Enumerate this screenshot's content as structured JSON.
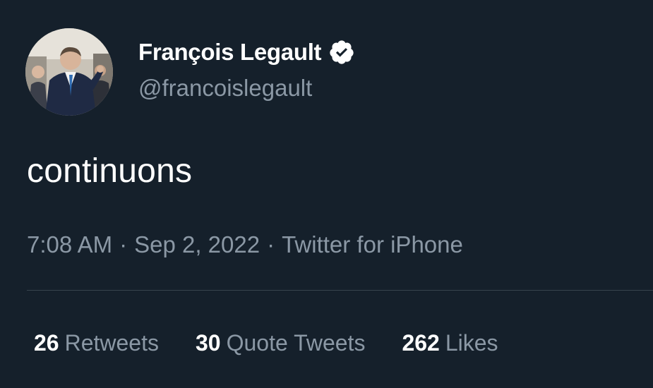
{
  "author": {
    "display_name": "François Legault",
    "handle": "@francoislegault",
    "verified": true,
    "avatar_icon": "profile-photo"
  },
  "tweet": {
    "text": "continuons",
    "time": "7:08 AM",
    "date": "Sep 2, 2022",
    "source": "Twitter for iPhone",
    "separator": "·"
  },
  "stats": [
    {
      "count": "26",
      "label": "Retweets"
    },
    {
      "count": "30",
      "label": "Quote Tweets"
    },
    {
      "count": "262",
      "label": "Likes"
    }
  ],
  "colors": {
    "background": "#15202b",
    "primary_text": "#ffffff",
    "secondary_text": "#8b98a5",
    "divider": "#38444d"
  }
}
